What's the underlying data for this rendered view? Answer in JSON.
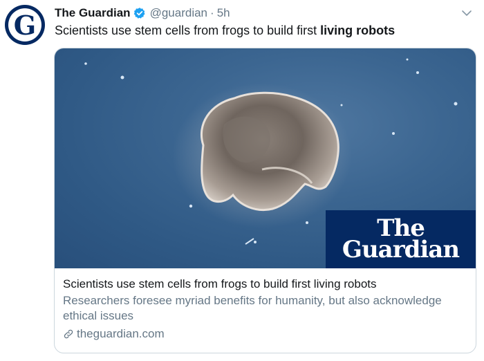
{
  "author": {
    "display_name": "The Guardian",
    "handle": "@guardian",
    "separator": "·",
    "time": "5h",
    "avatar_letter": "G",
    "verified": true
  },
  "tweet": {
    "text_plain": "Scientists use stem cells from frogs to build first ",
    "text_bold": "living robots"
  },
  "card": {
    "logo_line1": "The",
    "logo_line2": "Guardian",
    "title": "Scientists use stem cells from frogs to build first living robots",
    "description": "Researchers foresee myriad benefits for humanity, but also acknowledge ethical issues",
    "domain": "theguardian.com"
  },
  "colors": {
    "guardian_blue": "#052962",
    "verified_blue": "#1da1f2",
    "secondary_text": "#657786",
    "border": "#ccd6dd"
  },
  "icons": {
    "verified": "verified-badge-icon",
    "caret": "chevron-down-icon",
    "link": "link-icon"
  }
}
